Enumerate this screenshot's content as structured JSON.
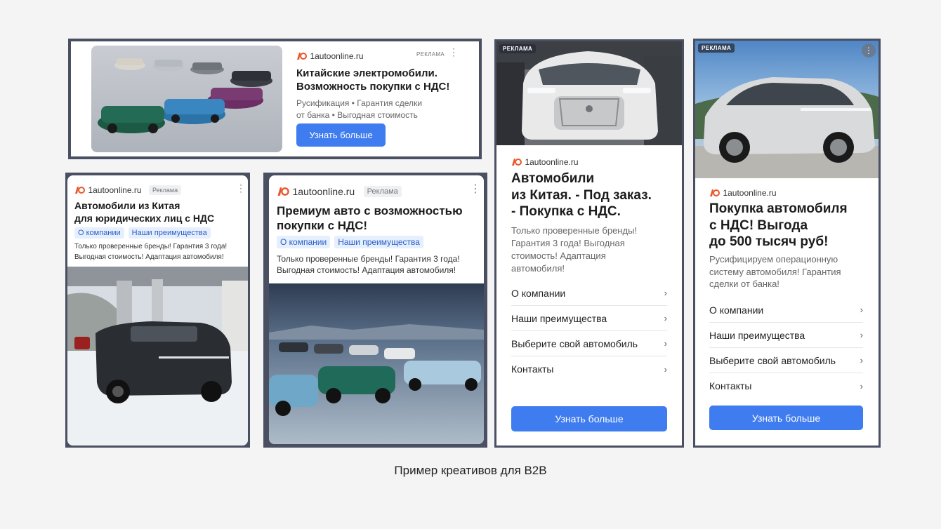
{
  "caption": "Пример креативов для B2B",
  "colors": {
    "accent": "#3f7cf0",
    "frame": "#4a5062",
    "logo": "#e8552a"
  },
  "ad1": {
    "domain": "1autoonline.ru",
    "ad_label": "РЕКЛАМА",
    "title_line1": "Китайские электромобили.",
    "title_line2": "Возможность покупки с НДС!",
    "desc_line1": "Русификация • Гарантия сделки",
    "desc_line2": "от банка • Выгодная стоимость",
    "button": "Узнать больше"
  },
  "ad2": {
    "domain": "1autoonline.ru",
    "ad_label": "Реклама",
    "title_line1": "Автомобили из Китая",
    "title_line2": "для юридических лиц с НДС",
    "pills": [
      "О компании",
      "Наши преимущества"
    ],
    "desc_line1": "Только проверенные бренды! Гарантия 3 года!",
    "desc_line2": "Выгодная стоимость! Адаптация автомобиля!"
  },
  "ad3": {
    "domain": "1autoonline.ru",
    "ad_label": "Реклама",
    "title_line1": "Премиум авто с возможностью",
    "title_line2": "покупки с НДС!",
    "pills": [
      "О компании",
      "Наши преимущества"
    ],
    "desc_line1": "Только проверенные бренды! Гарантия 3 года!",
    "desc_line2": "Выгодная стоимость! Адаптация автомобиля!"
  },
  "ad4": {
    "ad_label": "РЕКЛАМА",
    "domain": "1autoonline.ru",
    "title_line1": "Автомобили",
    "title_line2": "из Китая. - Под заказ.",
    "title_line3": "- Покупка с НДС.",
    "desc_line1": "Только проверенные бренды!",
    "desc_line2": "Гарантия 3 года! Выгодная",
    "desc_line3": "стоимость! Адаптация",
    "desc_line4": "автомобиля!",
    "menu": [
      "О компании",
      "Наши преимущества",
      "Выберите свой автомобиль",
      "Контакты"
    ],
    "button": "Узнать больше"
  },
  "ad5": {
    "ad_label": "РЕКЛАМА",
    "domain": "1autoonline.ru",
    "title_line1": "Покупка автомобиля",
    "title_line2": "с НДС! Выгода",
    "title_line3": "до 500 тысяч руб!",
    "desc_line1": "Русифицируем операционную",
    "desc_line2": "систему автомобиля! Гарантия",
    "desc_line3": "сделки от банка!",
    "menu": [
      "О компании",
      "Наши преимущества",
      "Выберите свой автомобиль",
      "Контакты"
    ],
    "button": "Узнать больше"
  },
  "icons": {
    "logo": "1autoonline-logo-icon",
    "more": "more-vertical-icon",
    "chevron": "chevron-right-icon"
  }
}
